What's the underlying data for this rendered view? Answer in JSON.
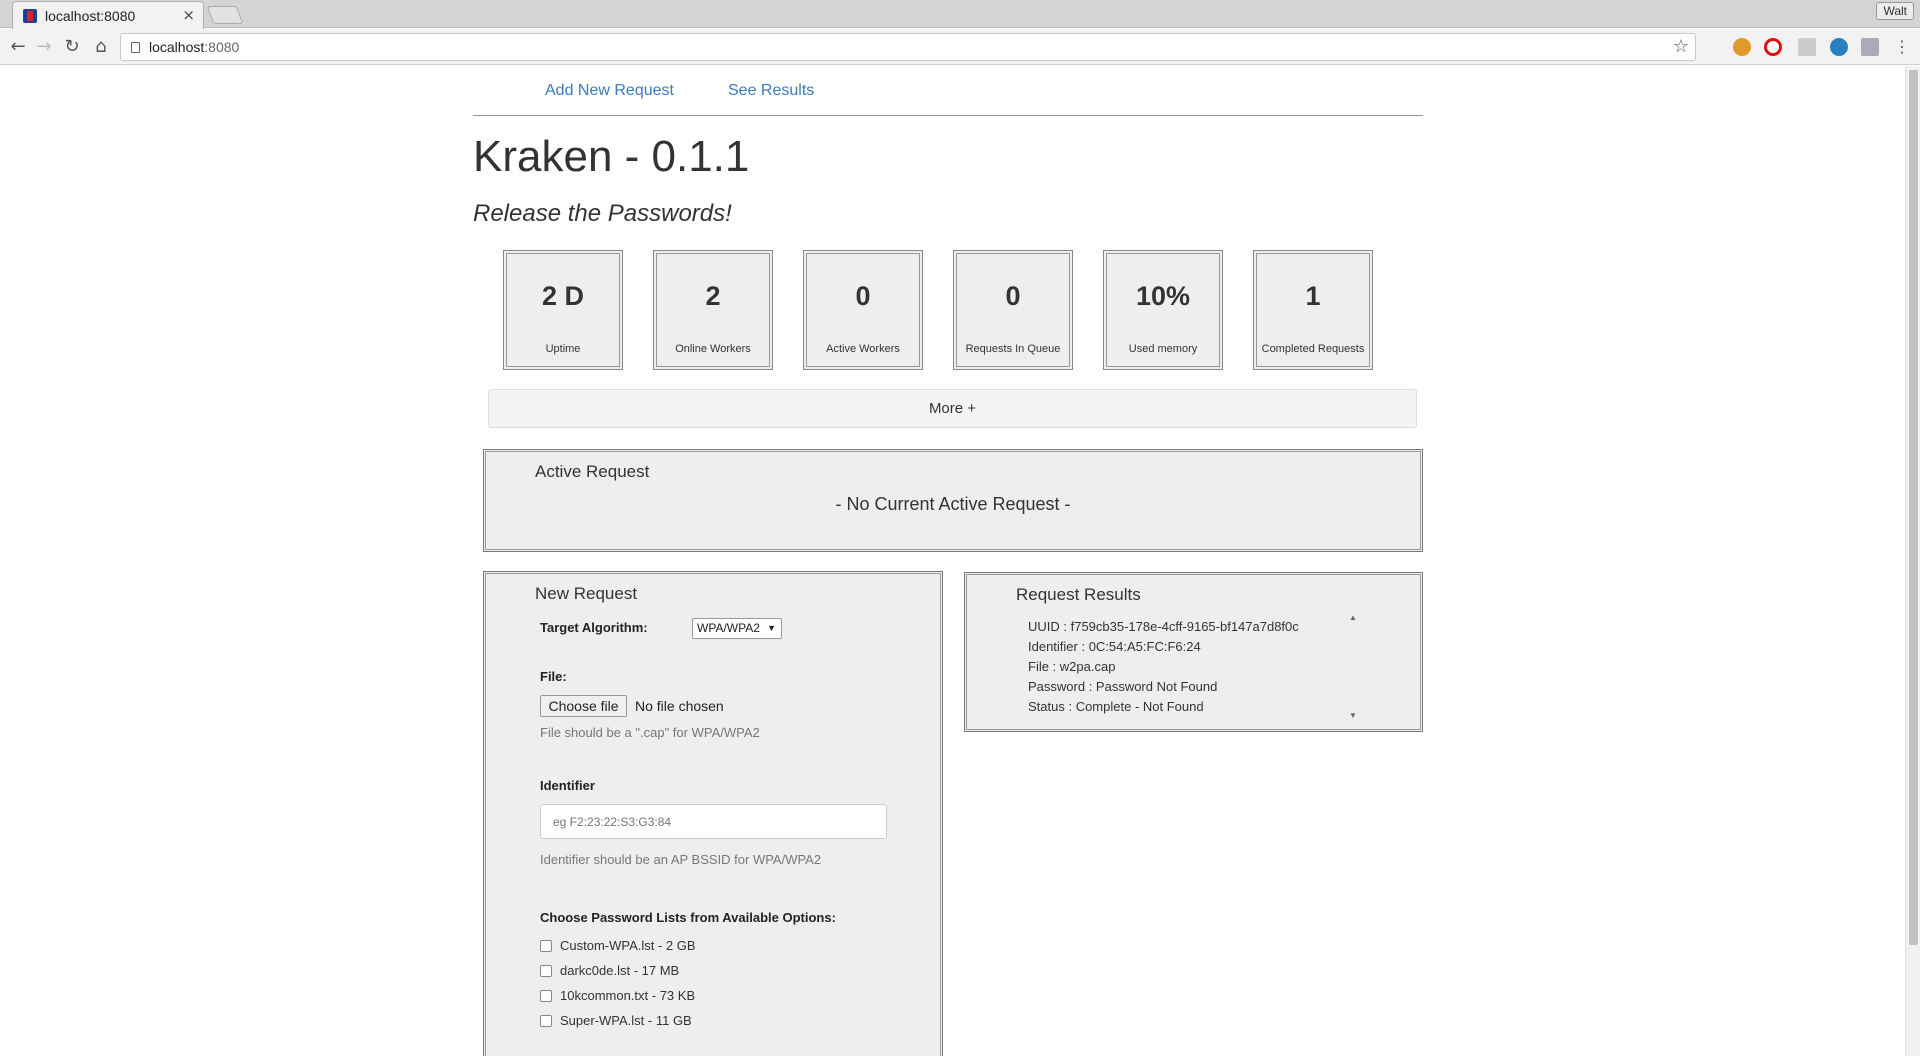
{
  "browser": {
    "tab_title": "localhost:8080",
    "tab_close": "×",
    "profile": "Walt",
    "url_host": "localhost",
    "url_port": ":8080",
    "back": "←",
    "forward": "→",
    "reload": "↻",
    "home": "⌂",
    "star": "☆",
    "menu": "⋮"
  },
  "nav": {
    "add_request": "Add New Request",
    "see_results": "See Results"
  },
  "header": {
    "title": "Kraken - 0.1.1",
    "tagline": "Release the Passwords!"
  },
  "stats": [
    {
      "value": "2 D",
      "label": "Uptime"
    },
    {
      "value": "2",
      "label": "Online Workers"
    },
    {
      "value": "0",
      "label": "Active Workers"
    },
    {
      "value": "0",
      "label": "Requests In Queue"
    },
    {
      "value": "10%",
      "label": "Used memory"
    },
    {
      "value": "1",
      "label": "Completed Requests"
    }
  ],
  "more_button": "More +",
  "active_request": {
    "title": "Active Request",
    "empty_text": "- No Current Active Request -"
  },
  "new_request": {
    "title": "New Request",
    "algorithm_label": "Target Algorithm:",
    "algorithm_value": "WPA/WPA2",
    "file_label": "File:",
    "choose_file": "Choose file",
    "no_file": "No file chosen",
    "file_hint": "File should be a \".cap\" for WPA/WPA2",
    "identifier_label": "Identifier",
    "identifier_placeholder": "eg F2:23:22:S3:G3:84",
    "identifier_hint": "Identifier should be an AP BSSID for WPA/WPA2",
    "lists_label": "Choose Password Lists from Available Options:",
    "lists": [
      "Custom-WPA.lst - 2 GB",
      "darkc0de.lst - 17 MB",
      "10kcommon.txt - 73 KB",
      "Super-WPA.lst - 11 GB"
    ]
  },
  "request_results": {
    "title": "Request Results",
    "lines": [
      "UUID : f759cb35-178e-4cff-9165-bf147a7d8f0c",
      "Identifier : 0C:54:A5:FC:F6:24",
      "File : w2pa.cap",
      "Password : Password Not Found",
      "Status : Complete - Not Found"
    ]
  },
  "colors": {
    "link": "#3a7cbd",
    "panel_bg": "#eeeeee",
    "hint": "#777777"
  }
}
